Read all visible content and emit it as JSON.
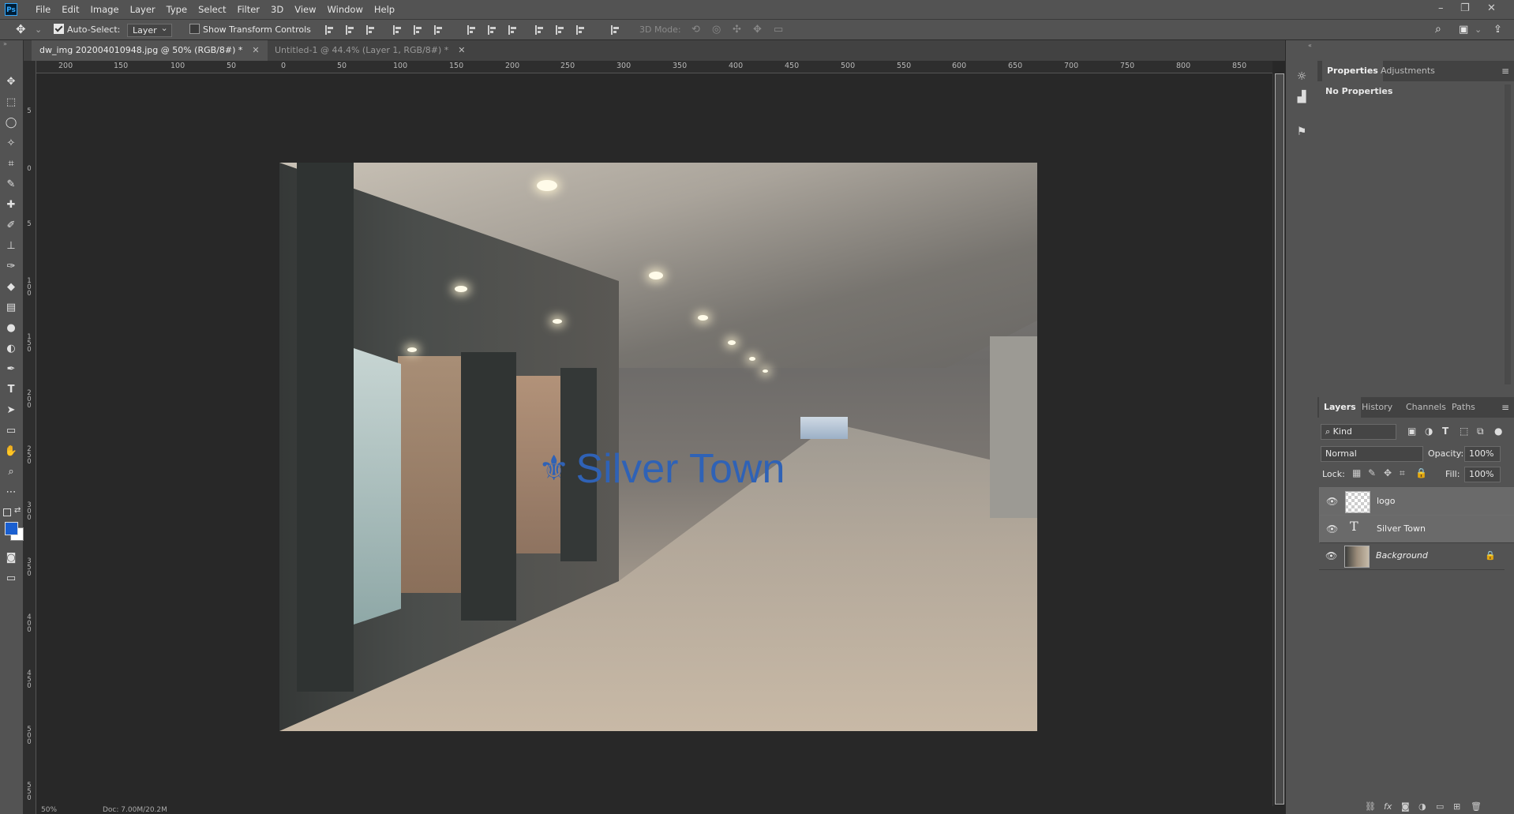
{
  "app": {
    "logo_text": "Ps"
  },
  "menu": [
    "File",
    "Edit",
    "Image",
    "Layer",
    "Type",
    "Select",
    "Filter",
    "3D",
    "View",
    "Window",
    "Help"
  ],
  "window_controls": {
    "minimize": "–",
    "restore": "❐",
    "close": "✕"
  },
  "options": {
    "auto_select_label": "Auto-Select:",
    "auto_select_value": "Layer",
    "show_transform_label": "Show Transform Controls",
    "mode_3d_label": "3D Mode:"
  },
  "tabs": [
    {
      "label": "dw_img 202004010948.jpg @ 50% (RGB/8#) *"
    },
    {
      "label": "Untitled-1 @ 44.4% (Layer 1, RGB/8#) *"
    }
  ],
  "ruler_top": [
    "200",
    "150",
    "100",
    "50",
    "0",
    "50",
    "100",
    "150",
    "200",
    "250",
    "300",
    "350",
    "400",
    "450",
    "500",
    "550",
    "600",
    "650",
    "700",
    "750",
    "800",
    "850"
  ],
  "ruler_left": [
    "5",
    "0",
    "5",
    "1 0 0",
    "1 5 0",
    "2 0 0",
    "2 5 0",
    "3 0 0",
    "3 5 0",
    "4 0 0",
    "4 5 0",
    "5 0 0",
    "5 5 0"
  ],
  "canvas": {
    "overlay_text": "Silver Town",
    "overlay_symbol": "⚜"
  },
  "status": {
    "zoom": "50%",
    "doc": "Doc: 7.00M/20.2M"
  },
  "properties_panel": {
    "tabs": [
      "Properties",
      "Adjustments"
    ],
    "empty_text": "No Properties"
  },
  "layers_panel": {
    "tabs": [
      "Layers",
      "History",
      "Channels",
      "Paths"
    ],
    "kind_label": "Kind",
    "blend_mode": "Normal",
    "opacity_label": "Opacity:",
    "opacity_value": "100%",
    "lock_label": "Lock:",
    "fill_label": "Fill:",
    "fill_value": "100%",
    "layers": [
      {
        "name": "logo"
      },
      {
        "name": "Silver Town"
      },
      {
        "name": "Background"
      }
    ]
  },
  "colors": {
    "accent": "#31a8ff",
    "foreground": "#1a5fd0",
    "background": "#ffffff",
    "overlay_text": "#2f62b6"
  }
}
